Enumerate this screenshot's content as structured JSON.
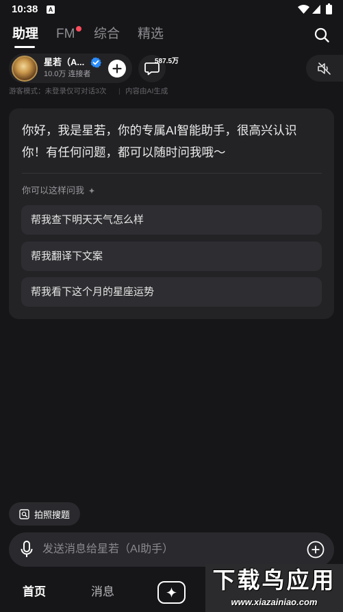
{
  "status_bar": {
    "time": "10:38",
    "notif_glyph": "A",
    "icons": [
      "a-notification-icon",
      "wifi-icon",
      "signal-icon",
      "battery-icon"
    ]
  },
  "top_tabs": {
    "items": [
      {
        "label": "助理",
        "active": true
      },
      {
        "label": "FM",
        "badge_dot": true
      },
      {
        "label": "综合"
      },
      {
        "label": "精选"
      }
    ],
    "search_icon": "search-icon"
  },
  "assistant": {
    "name": "星若（A...",
    "followers": "10.0万 连接者",
    "verified": true,
    "chat_count": "587.5万",
    "icons": [
      "avatar",
      "verified-icon",
      "plus-icon",
      "chat-bubble-icon",
      "speaker-mute-icon"
    ]
  },
  "notice": {
    "guest": "游客模式：未登录仅可对话3次",
    "separator": "|",
    "ai_note": "内容由AI生成"
  },
  "welcome_card": {
    "greeting_lines": [
      "你好，我是星若，你的专属AI智能助手，很高兴认识",
      "你！有任何问题，都可以随时问我哦～"
    ],
    "suggest_title": "你可以这样问我",
    "suggest_icon": "sparkle-icon",
    "suggestions": [
      "帮我查下明天天气怎么样",
      "帮我翻译下文案",
      "帮我看下这个月的星座运势"
    ]
  },
  "photo_search": {
    "label": "拍照搜题",
    "icon": "photo-search-icon"
  },
  "composer": {
    "placeholder": "发送消息给星若（AI助手）",
    "left_icon": "microphone-icon",
    "right_icon": "plus-circle-icon"
  },
  "bottom_nav": {
    "items": [
      {
        "label": "首页",
        "active": true
      },
      {
        "label": "消息"
      }
    ],
    "center_icon": "sparkle-create-icon"
  },
  "watermark": {
    "title": "下载鸟应用",
    "url": "www.xiazainiao.com"
  },
  "colors": {
    "background": "#161618",
    "card": "#232326",
    "chip": "#2e2e32",
    "accent_blue": "#2b8cff",
    "badge_red": "#ff4d5e"
  }
}
